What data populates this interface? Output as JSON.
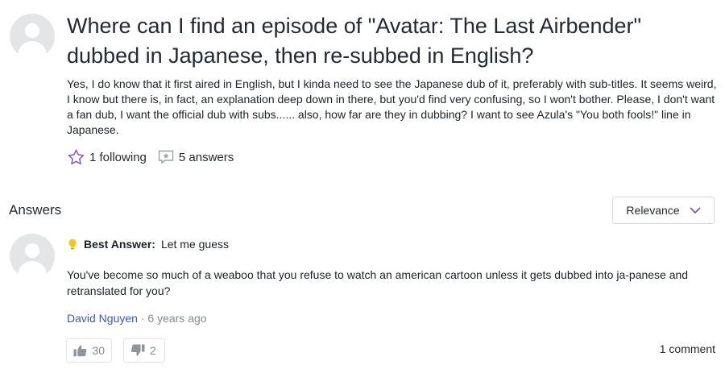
{
  "question": {
    "title": "Where can I find an episode of \"Avatar: The Last Airbender\" dubbed in Japanese, then re-subbed in English?",
    "body": "Yes, I do know that it first aired in English, but I kinda need to see the Japanese dub of it, preferably with sub-titles. It seems weird, I know but there is, in fact, an explanation deep down in there, but you'd find very confusing, so I won't bother. Please, I don't want a fan dub, I want the official dub with subs...... also, how far are they in dubbing? I want to see Azula's \"You both fools!\" line in Japanese.",
    "following_label": "1 following",
    "answers_label": "5 answers"
  },
  "answers_section": {
    "header": "Answers",
    "sort_selected": "Relevance"
  },
  "best_answer": {
    "label": "Best Answer:",
    "lead": "Let me guess",
    "body": "You've become so much of a weaboo that you refuse to watch an american cartoon unless it gets dubbed into ja-panese and retranslated for you?",
    "author": "David Nguyen",
    "separator": " · ",
    "time": "6 years ago",
    "upvotes": "30",
    "downvotes": "2",
    "comments_label": "1 comment"
  },
  "colors": {
    "accent_purple": "#7e57c2",
    "author_link": "#3d5aa3",
    "muted": "#828a93",
    "avatar_bg": "#e4e5e7"
  },
  "icons": [
    "default-avatar-icon",
    "star-outline-icon",
    "answer-bubble-icon",
    "chevron-down-icon",
    "bulb-icon",
    "thumbs-up-icon",
    "thumbs-down-icon"
  ]
}
